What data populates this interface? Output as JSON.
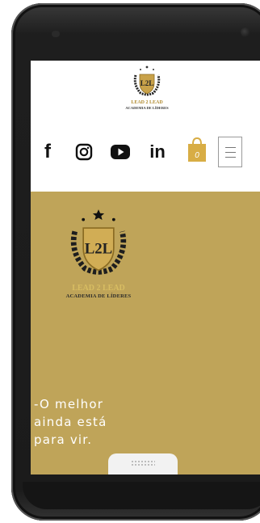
{
  "header": {
    "logo": {
      "brand": "LEAD 2 LEAD",
      "subtitle": "ACADEMIA DE LÍDERES",
      "emblem_text": "L2L"
    },
    "social": [
      {
        "name": "facebook",
        "glyph": "f"
      },
      {
        "name": "instagram",
        "icon": "instagram-icon"
      },
      {
        "name": "youtube",
        "icon": "youtube-icon"
      },
      {
        "name": "linkedin",
        "glyph": "in"
      }
    ],
    "cart": {
      "icon": "shopping-bag-icon",
      "count": "0"
    },
    "menu": {
      "icon": "hamburger-menu-icon"
    }
  },
  "hero": {
    "background_color": "#bfa459",
    "logo": {
      "brand": "LEAD 2 LEAD",
      "subtitle": "ACADEMIA DE LÍDERES",
      "emblem_text": "L2L"
    },
    "tagline": "-O melhor\nainda está\npara vir."
  },
  "colors": {
    "gold": "#bfa459",
    "accent_gold": "#d8ad45",
    "device": "#1b1b1b"
  }
}
